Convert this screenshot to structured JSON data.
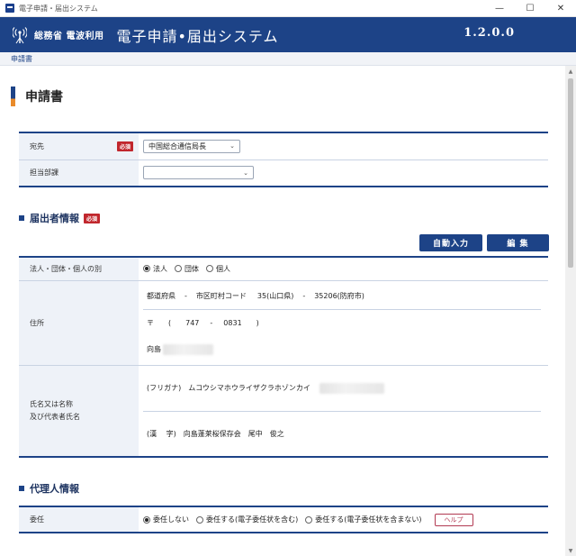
{
  "window": {
    "title": "電子申請・届出システム",
    "controls": {
      "minimize": "—",
      "maximize": "☐",
      "close": "✕"
    }
  },
  "header": {
    "ministry": "総務省 電波利用",
    "system_title": "電子申請•届出システム",
    "version": "1.2.0.0"
  },
  "breadcrumb": "申請書",
  "page_title": "申請書",
  "colors": {
    "brand": "#1d4387",
    "accent": "#e98b2a",
    "required": "#c1272d"
  },
  "basic": {
    "destination_label": "宛先",
    "required": "必須",
    "destination_value": "中国総合通信局長",
    "department_label": "担当部課",
    "department_value": ""
  },
  "applicant": {
    "section_title": "届出者情報",
    "required": "必須",
    "auto_input_button": "自動入力",
    "edit_button": "編 集",
    "type_label": "法人・団体・個人の別",
    "type_options": [
      "法人",
      "団体",
      "個人"
    ],
    "address_label": "住所",
    "pref_label": "都道府県",
    "dash": "-",
    "city_code_label": "市区町村コード",
    "pref_value": "35(山口県)",
    "city_value": "35206(防府市)",
    "postal_mark": "〒",
    "paren_open": "(",
    "paren_close": ")",
    "postal_first": "747",
    "postal_second": "0831",
    "street": "向島",
    "name_label_line1": "氏名又は名称",
    "name_label_line2": "及び代表者氏名",
    "furigana_label": "(フリガナ)",
    "furigana_value": "ムコウシマホウライザクラホゾンカイ",
    "kanji_label": "(漢　 字)",
    "kanji_value": "向島蓬莱桜保存会　尾中　俊之"
  },
  "agent": {
    "section_title": "代理人情報",
    "delegation_label": "委任",
    "options": [
      "委任しない",
      "委任する(電子委任状を含む)",
      "委任する(電子委任状を含まない)"
    ],
    "help_button": "ヘルプ"
  }
}
